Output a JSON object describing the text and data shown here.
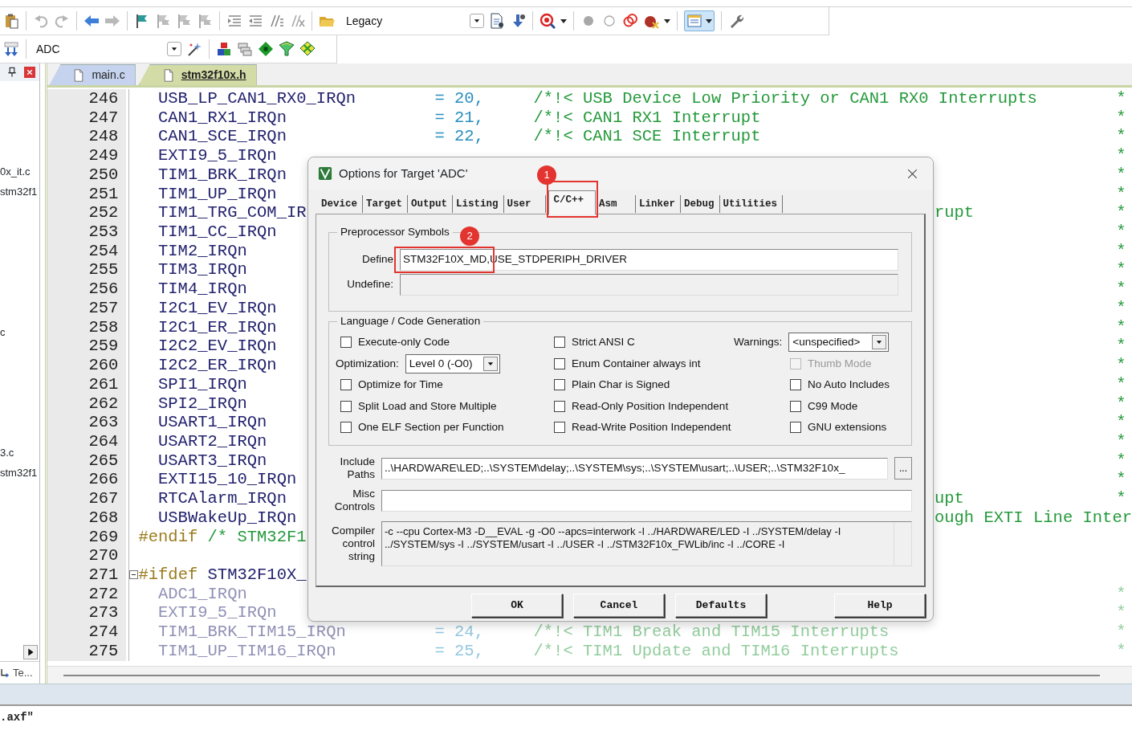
{
  "toolbar_1": {
    "combo": "Legacy"
  },
  "toolbar_2": {
    "target": "ADC"
  },
  "project_panel": {
    "items": [
      {
        "label": "0x_it.c"
      },
      {
        "label": "stm32f1"
      },
      {
        "label": "c"
      },
      {
        "label": "3.c"
      },
      {
        "label": "stm32f1"
      }
    ],
    "bottom_tab": "Te..."
  },
  "editor": {
    "tabs": [
      {
        "label": "main.c",
        "selected": false
      },
      {
        "label": "stm32f10x.h",
        "selected": true
      }
    ],
    "lines": [
      {
        "number": "246",
        "inactive": false,
        "fold_start": false,
        "segments": [
          {
            "kind": "ident",
            "text": "USB_LP_CAN1_RX0_IRQn"
          },
          {
            "kind": "value",
            "text": "= 20,"
          },
          {
            "kind": "comment",
            "text": "/*!< USB Device Low Priority or CAN1 RX0 Interrupts"
          },
          {
            "kind": "end",
            "text": "*"
          }
        ]
      },
      {
        "number": "247",
        "inactive": false,
        "fold_start": false,
        "segments": [
          {
            "kind": "ident",
            "text": "CAN1_RX1_IRQn"
          },
          {
            "kind": "value",
            "text": "= 21,"
          },
          {
            "kind": "comment",
            "text": "/*!< CAN1 RX1 Interrupt"
          },
          {
            "kind": "end",
            "text": "*"
          }
        ]
      },
      {
        "number": "248",
        "inactive": false,
        "fold_start": false,
        "segments": [
          {
            "kind": "ident",
            "text": "CAN1_SCE_IRQn"
          },
          {
            "kind": "value",
            "text": "= 22,"
          },
          {
            "kind": "comment",
            "text": "/*!< CAN1 SCE Interrupt"
          },
          {
            "kind": "end",
            "text": "*"
          }
        ]
      },
      {
        "number": "249",
        "inactive": false,
        "fold_start": false,
        "segments": [
          {
            "kind": "ident",
            "text": "EXTI9_5_IRQn"
          },
          {
            "kind": "end",
            "text": "*"
          }
        ]
      },
      {
        "number": "250",
        "inactive": false,
        "fold_start": false,
        "segments": [
          {
            "kind": "ident",
            "text": "TIM1_BRK_IRQn"
          },
          {
            "kind": "end",
            "text": "*"
          }
        ]
      },
      {
        "number": "251",
        "inactive": false,
        "fold_start": false,
        "segments": [
          {
            "kind": "ident",
            "text": "TIM1_UP_IRQn"
          },
          {
            "kind": "end",
            "text": "*"
          }
        ]
      },
      {
        "number": "252",
        "inactive": false,
        "fold_start": false,
        "segments": [
          {
            "kind": "ident",
            "text": "TIM1_TRG_COM_IR"
          },
          {
            "kind": "tail",
            "text": "rupt"
          },
          {
            "kind": "end",
            "text": "*"
          }
        ]
      },
      {
        "number": "253",
        "inactive": false,
        "fold_start": false,
        "segments": [
          {
            "kind": "ident",
            "text": "TIM1_CC_IRQn"
          },
          {
            "kind": "end",
            "text": "*"
          }
        ]
      },
      {
        "number": "254",
        "inactive": false,
        "fold_start": false,
        "segments": [
          {
            "kind": "ident",
            "text": "TIM2_IRQn"
          },
          {
            "kind": "end",
            "text": "*"
          }
        ]
      },
      {
        "number": "255",
        "inactive": false,
        "fold_start": false,
        "segments": [
          {
            "kind": "ident",
            "text": "TIM3_IRQn"
          },
          {
            "kind": "end",
            "text": "*"
          }
        ]
      },
      {
        "number": "256",
        "inactive": false,
        "fold_start": false,
        "segments": [
          {
            "kind": "ident",
            "text": "TIM4_IRQn"
          },
          {
            "kind": "end",
            "text": "*"
          }
        ]
      },
      {
        "number": "257",
        "inactive": false,
        "fold_start": false,
        "segments": [
          {
            "kind": "ident",
            "text": "I2C1_EV_IRQn"
          },
          {
            "kind": "end",
            "text": "*"
          }
        ]
      },
      {
        "number": "258",
        "inactive": false,
        "fold_start": false,
        "segments": [
          {
            "kind": "ident",
            "text": "I2C1_ER_IRQn"
          },
          {
            "kind": "end",
            "text": "*"
          }
        ]
      },
      {
        "number": "259",
        "inactive": false,
        "fold_start": false,
        "segments": [
          {
            "kind": "ident",
            "text": "I2C2_EV_IRQn"
          },
          {
            "kind": "end",
            "text": "*"
          }
        ]
      },
      {
        "number": "260",
        "inactive": false,
        "fold_start": false,
        "segments": [
          {
            "kind": "ident",
            "text": "I2C2_ER_IRQn"
          },
          {
            "kind": "end",
            "text": "*"
          }
        ]
      },
      {
        "number": "261",
        "inactive": false,
        "fold_start": false,
        "segments": [
          {
            "kind": "ident",
            "text": "SPI1_IRQn"
          },
          {
            "kind": "end",
            "text": "*"
          }
        ]
      },
      {
        "number": "262",
        "inactive": false,
        "fold_start": false,
        "segments": [
          {
            "kind": "ident",
            "text": "SPI2_IRQn"
          },
          {
            "kind": "end",
            "text": "*"
          }
        ]
      },
      {
        "number": "263",
        "inactive": false,
        "fold_start": false,
        "segments": [
          {
            "kind": "ident",
            "text": "USART1_IRQn"
          },
          {
            "kind": "end",
            "text": "*"
          }
        ]
      },
      {
        "number": "264",
        "inactive": false,
        "fold_start": false,
        "segments": [
          {
            "kind": "ident",
            "text": "USART2_IRQn"
          },
          {
            "kind": "end",
            "text": "*"
          }
        ]
      },
      {
        "number": "265",
        "inactive": false,
        "fold_start": false,
        "segments": [
          {
            "kind": "ident",
            "text": "USART3_IRQn"
          },
          {
            "kind": "end",
            "text": "*"
          }
        ]
      },
      {
        "number": "266",
        "inactive": false,
        "fold_start": false,
        "segments": [
          {
            "kind": "ident",
            "text": "EXTI15_10_IRQn"
          },
          {
            "kind": "end",
            "text": "*"
          }
        ]
      },
      {
        "number": "267",
        "inactive": false,
        "fold_start": false,
        "segments": [
          {
            "kind": "ident",
            "text": "RTCAlarm_IRQn"
          },
          {
            "kind": "tail",
            "text": "upt"
          },
          {
            "kind": "end",
            "text": "*"
          }
        ]
      },
      {
        "number": "268",
        "inactive": false,
        "fold_start": false,
        "segments": [
          {
            "kind": "ident",
            "text": "USBWakeUp_IRQn"
          },
          {
            "kind": "tail",
            "text": "ough EXTI Line Inter"
          }
        ]
      },
      {
        "number": "269",
        "inactive": false,
        "fold_start": false,
        "segments": [
          {
            "kind": "directive",
            "text": "#endif"
          },
          {
            "kind": "pp_comment",
            "text": "/* STM32F1"
          }
        ]
      },
      {
        "number": "270",
        "fold_start": false
      },
      {
        "number": "271",
        "inactive": false,
        "fold_start": true,
        "segments": [
          {
            "kind": "directive",
            "text": "#ifdef"
          },
          {
            "kind": "pp_ident",
            "text": "STM32F10X_"
          }
        ]
      },
      {
        "number": "272",
        "inactive": true,
        "fold_start": false,
        "segments": [
          {
            "kind": "ident",
            "text": "ADC1_IRQn"
          },
          {
            "kind": "end",
            "text": "*"
          }
        ]
      },
      {
        "number": "273",
        "inactive": true,
        "fold_start": false,
        "segments": [
          {
            "kind": "ident",
            "text": "EXTI9_5_IRQn"
          },
          {
            "kind": "end",
            "text": "*"
          }
        ]
      },
      {
        "number": "274",
        "inactive": true,
        "fold_start": false,
        "segments": [
          {
            "kind": "ident",
            "text": "TIM1_BRK_TIM15_IRQn"
          },
          {
            "kind": "value",
            "text": "= 24,"
          },
          {
            "kind": "comment",
            "text": "/*!< TIM1 Break and TIM15 Interrupts"
          },
          {
            "kind": "end",
            "text": "*"
          }
        ]
      },
      {
        "number": "275",
        "inactive": true,
        "fold_start": false,
        "segments": [
          {
            "kind": "ident",
            "text": "TIM1_UP_TIM16_IRQn"
          },
          {
            "kind": "value",
            "text": "= 25,"
          },
          {
            "kind": "comment",
            "text": "/*!< TIM1 Update and TIM16 Interrupts"
          },
          {
            "kind": "end",
            "text": "*"
          }
        ]
      }
    ]
  },
  "output": {
    "lines": [
      ".axf\""
    ]
  },
  "dialog": {
    "title": "Options for Target 'ADC'",
    "tabs": [
      {
        "label": "Device",
        "selected": false
      },
      {
        "label": "Target",
        "selected": false
      },
      {
        "label": "Output",
        "selected": false
      },
      {
        "label": "Listing",
        "selected": false
      },
      {
        "label": "User",
        "selected": false
      },
      {
        "label": "C/C++",
        "selected": true
      },
      {
        "label": "Asm",
        "selected": false
      },
      {
        "label": "Linker",
        "selected": false
      },
      {
        "label": "Debug",
        "selected": false
      },
      {
        "label": "Utilities",
        "selected": false
      }
    ],
    "preprocessor": {
      "title": "Preprocessor Symbols",
      "define_label": "Define",
      "define": "STM32F10X_MD,USE_STDPERIPH_DRIVER",
      "undefine_label": "Undefine:"
    },
    "language": {
      "title": "Language / Code Generation",
      "columns": [
        [
          {
            "kind": "checkbox",
            "label": "Execute-only Code",
            "checked": false,
            "disabled": false
          },
          {
            "kind": "select",
            "label": "Optimization:",
            "value": "Level 0 (-O0)"
          },
          {
            "kind": "checkbox",
            "label": "Optimize for Time",
            "checked": false,
            "disabled": false
          },
          {
            "kind": "checkbox",
            "label": "Split Load and Store Multiple",
            "checked": false,
            "disabled": false
          },
          {
            "kind": "checkbox",
            "label": "One ELF Section per Function",
            "checked": false,
            "disabled": false
          }
        ],
        [
          {
            "kind": "checkbox",
            "label": "Strict ANSI C",
            "checked": false,
            "disabled": false
          },
          {
            "kind": "checkbox",
            "label": "Enum Container always int",
            "checked": false,
            "disabled": false
          },
          {
            "kind": "checkbox",
            "label": "Plain Char is Signed",
            "checked": false,
            "disabled": false
          },
          {
            "kind": "checkbox",
            "label": "Read-Only Position Independent",
            "checked": false,
            "disabled": false
          },
          {
            "kind": "checkbox",
            "label": "Read-Write Position Independent",
            "checked": false,
            "disabled": false
          }
        ],
        [
          {
            "kind": "select",
            "label": "Warnings:",
            "value": "<unspecified>"
          },
          {
            "kind": "checkbox",
            "label": "Thumb Mode",
            "checked": false,
            "disabled": true
          },
          {
            "kind": "checkbox",
            "label": "No Auto Includes",
            "checked": false,
            "disabled": false
          },
          {
            "kind": "checkbox",
            "label": "C99 Mode",
            "checked": false,
            "disabled": false
          },
          {
            "kind": "checkbox",
            "label": "GNU extensions",
            "checked": false,
            "disabled": false
          }
        ]
      ]
    },
    "include_label": "Include Paths",
    "include": "..\\HARDWARE\\LED;..\\SYSTEM\\delay;..\\SYSTEM\\sys;..\\SYSTEM\\usart;..\\USER;..\\STM32F10x_",
    "browse": "...",
    "misc_label": "Misc Controls",
    "compiler_label": "Compiler control string",
    "compiler_lines": [
      "-c --cpu Cortex-M3 -D__EVAL -g -O0 --apcs=interwork -I ../HARDWARE/LED -I ../SYSTEM/delay -I",
      "../SYSTEM/sys -I ../SYSTEM/usart -I ../USER -I ../STM32F10x_FWLib/inc -I ../CORE -I"
    ],
    "buttons": [
      "OK",
      "Cancel",
      "Defaults",
      "Help"
    ]
  },
  "annotations": [
    {
      "label": "1"
    },
    {
      "label": "2"
    }
  ]
}
